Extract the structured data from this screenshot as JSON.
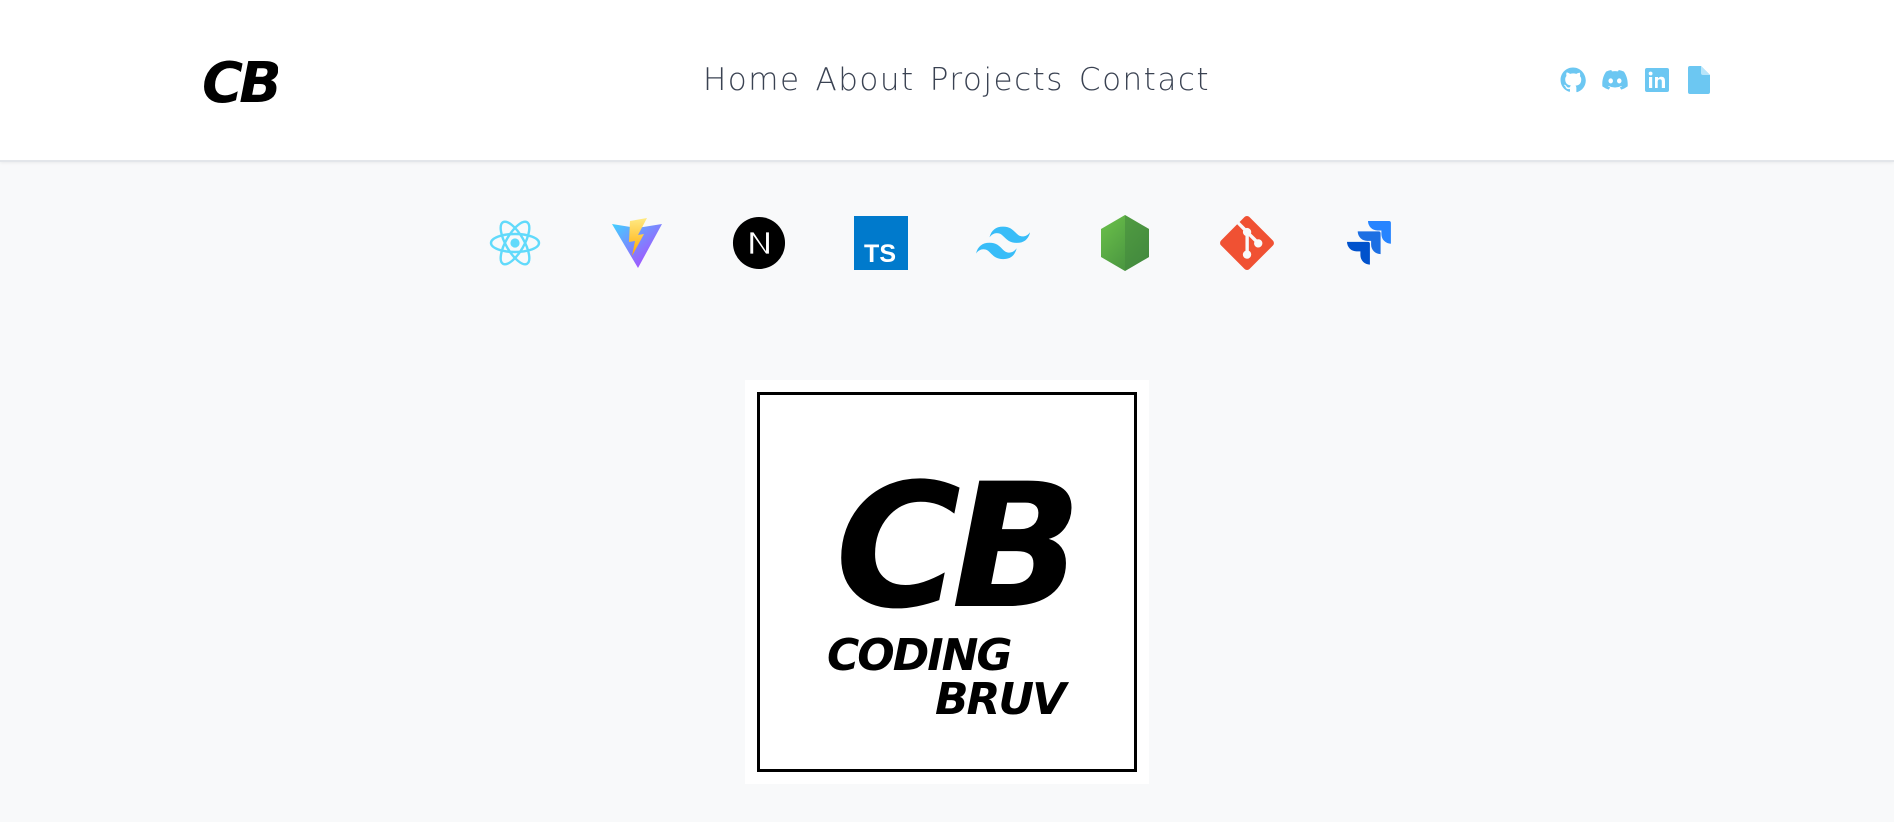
{
  "header": {
    "logo_text": "CB",
    "nav": [
      {
        "label": "Home"
      },
      {
        "label": "About"
      },
      {
        "label": "Projects"
      },
      {
        "label": "Contact"
      }
    ],
    "socials": [
      {
        "icon": "github-icon"
      },
      {
        "icon": "discord-icon"
      },
      {
        "icon": "linkedin-icon"
      },
      {
        "icon": "resume-document-icon"
      }
    ],
    "social_color": "#6cc7f2"
  },
  "tech_stack": [
    {
      "icon": "react-icon"
    },
    {
      "icon": "vite-icon"
    },
    {
      "icon": "nextjs-icon"
    },
    {
      "icon": "typescript-icon",
      "text": "TS"
    },
    {
      "icon": "tailwind-icon"
    },
    {
      "icon": "nodejs-icon"
    },
    {
      "icon": "git-icon"
    },
    {
      "icon": "jira-icon"
    }
  ],
  "hero": {
    "monogram": "CB",
    "line1": "CODING",
    "line2": "BRUV"
  }
}
